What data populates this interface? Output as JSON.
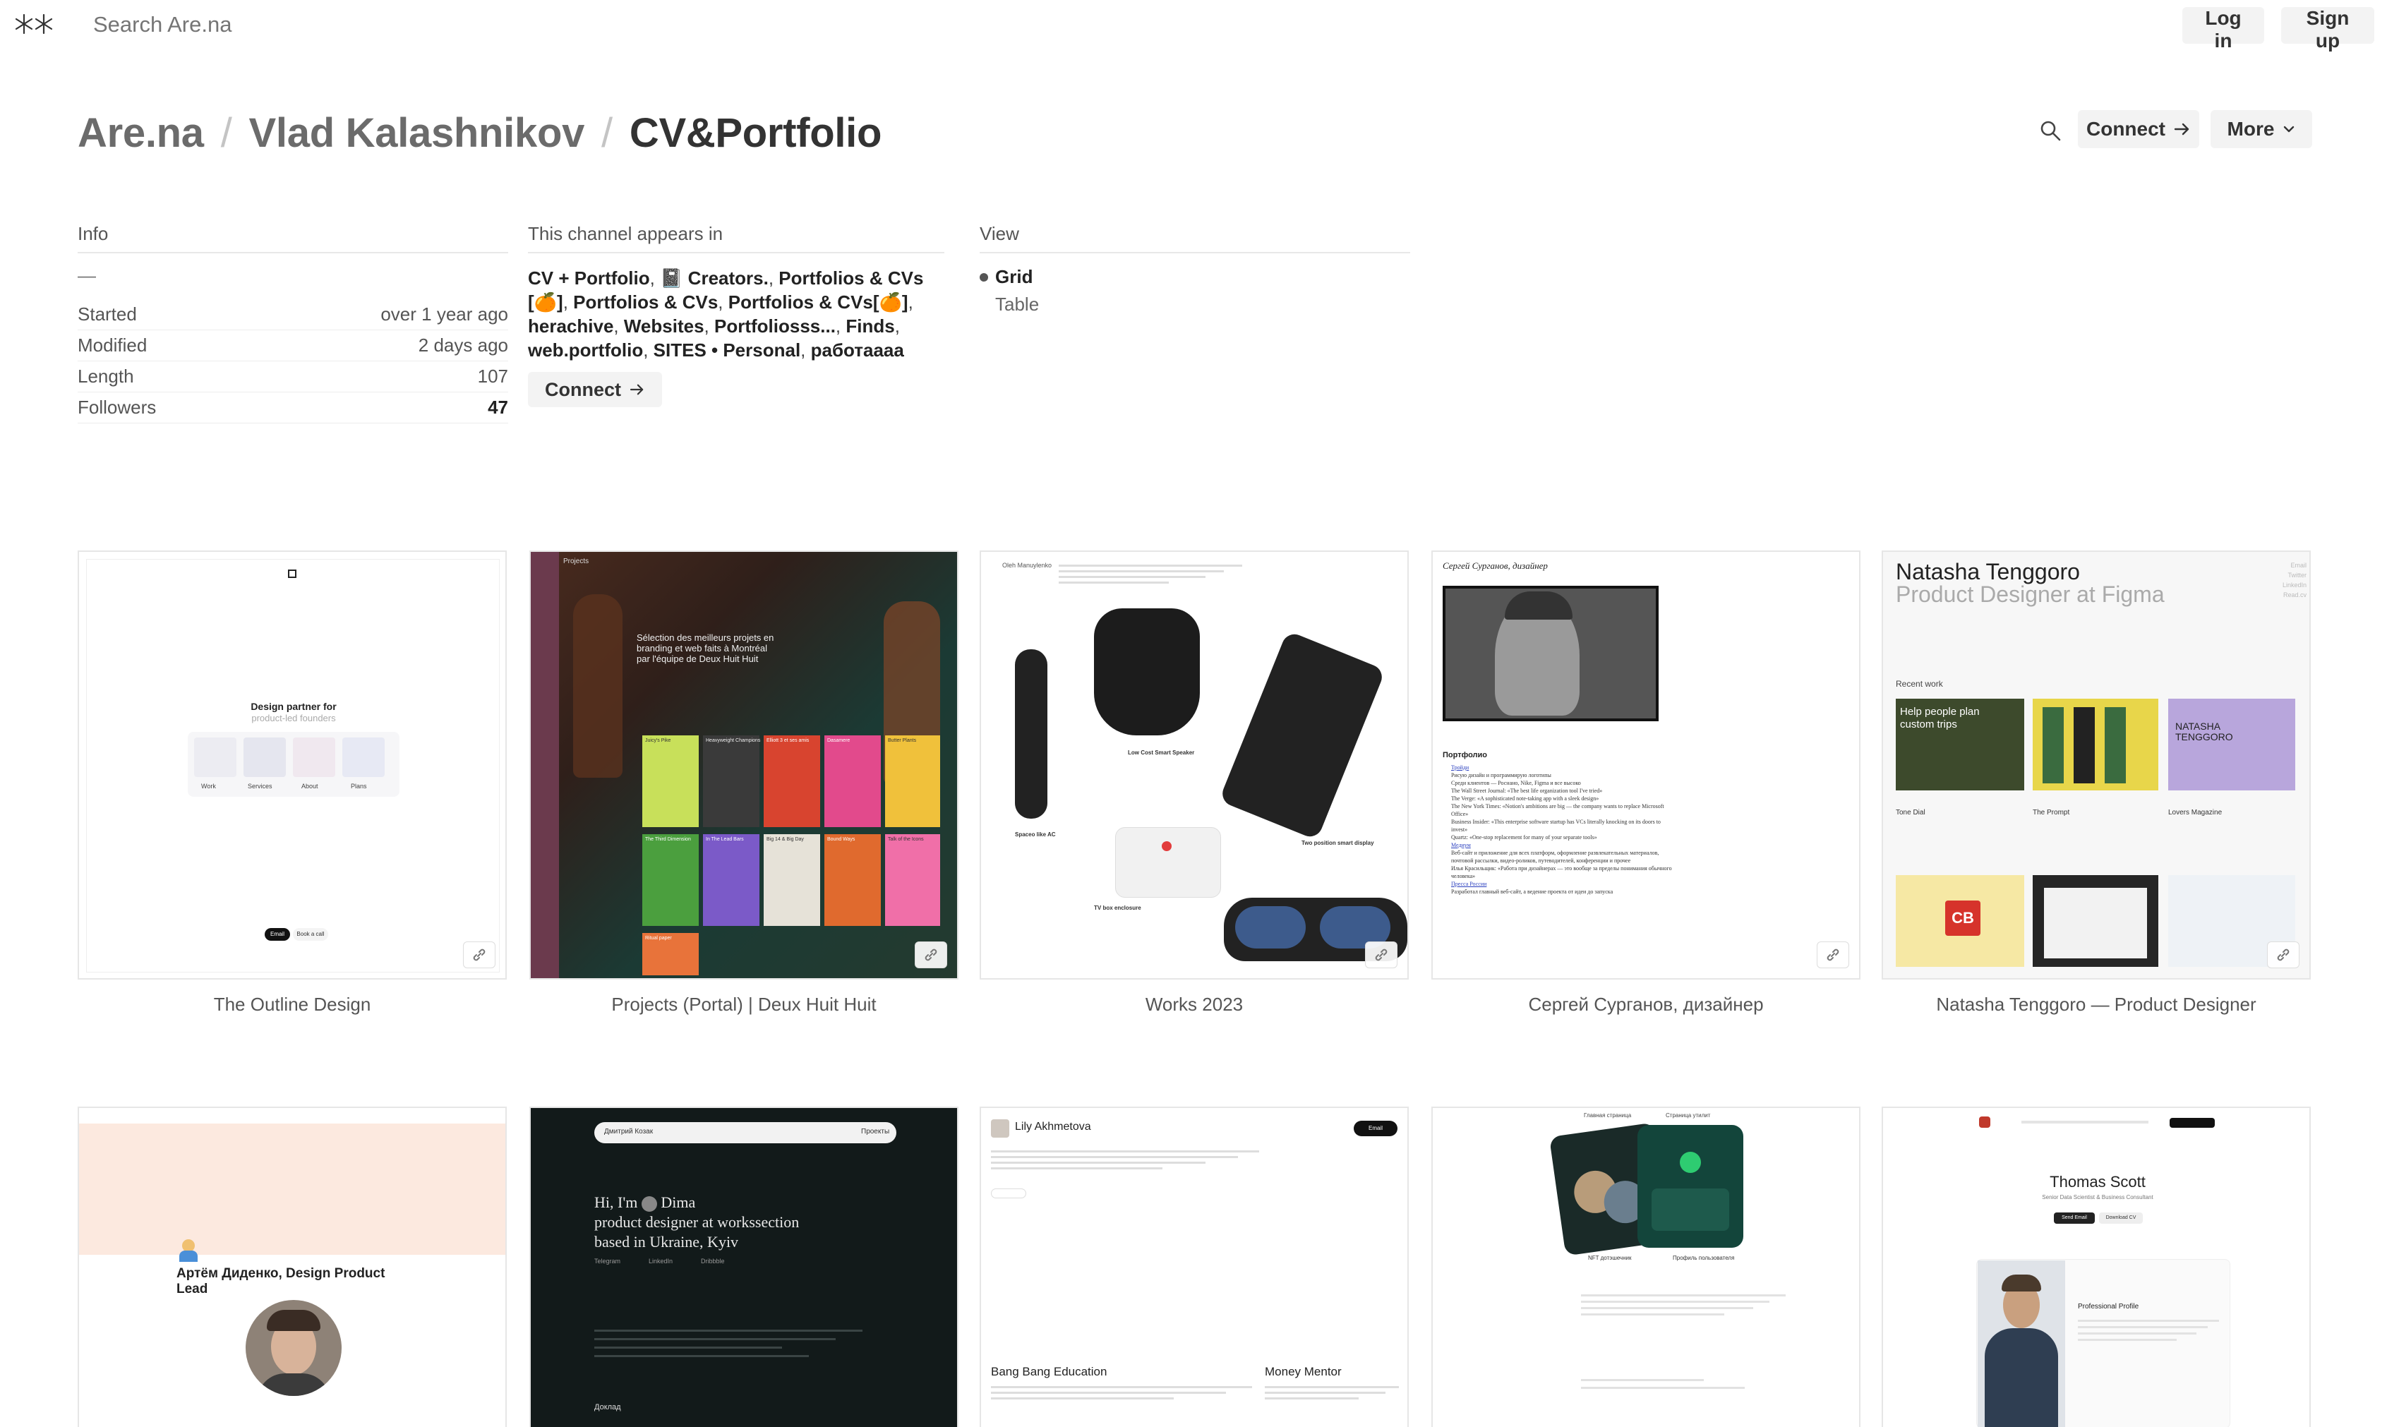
{
  "topbar": {
    "search_placeholder": "Search Are.na",
    "login_label": "Log in",
    "signup_label": "Sign up"
  },
  "breadcrumb": {
    "root": "Are.na",
    "user": "Vlad Kalashnikov",
    "channel": "CV&Portfolio"
  },
  "header_actions": {
    "connect_label": "Connect",
    "more_label": "More"
  },
  "info": {
    "title": "Info",
    "description": "—",
    "rows": [
      {
        "label": "Started",
        "value": "over 1 year ago"
      },
      {
        "label": "Modified",
        "value": "2 days ago"
      },
      {
        "label": "Length",
        "value": "107"
      },
      {
        "label": "Followers",
        "value": "47"
      }
    ]
  },
  "appears": {
    "title": "This channel appears in",
    "channels": [
      "CV + Portfolio",
      "📓 Creators.",
      "Portfolios & CVs [🍊]",
      "Portfolios & CVs",
      "Portfolios & CVs[🍊]",
      "herachive",
      "Websites",
      "Portfoliosss...",
      "Finds",
      "web.portfolio",
      "SITES • Personal",
      "работаааа"
    ],
    "connect_label": "Connect"
  },
  "view": {
    "title": "View",
    "options": [
      "Grid",
      "Table"
    ],
    "selected": "Grid"
  },
  "blocks": {
    "b1": {
      "title": "The Outline Design",
      "headline": "Design partner for",
      "subline": "product-led founders",
      "nav": [
        "Work",
        "Services",
        "About",
        "Plans"
      ],
      "btn1": "Email",
      "btn2": "Book a call"
    },
    "b2": {
      "title": "Projects (Portal) | Deux Huit Huit",
      "nav_label": "Projects",
      "headline": "Sélection des meilleurs projets en branding et web faits à Montréal par l'équipe de Deux Huit Huit",
      "tiles": [
        "Juicy's Pike",
        "Heavyweight Champions",
        "Elliott 3 et ses amis",
        "Dasamere",
        "Butter Plants",
        "The Third Dimension",
        "In The Lead Bars",
        "Big 14 & Big Day",
        "Bound Ways",
        "Talk of the Icons",
        "Ritual paper"
      ]
    },
    "b3": {
      "title": "Works 2023",
      "brand": "Oleh Manuylenko",
      "labels": [
        "Low Cost Smart Speaker",
        "Spaceo like AC",
        "Two position smart display",
        "TV box enclosure"
      ]
    },
    "b4": {
      "title": "Сергей Сурганов, дизайнер",
      "heading": "Сергей Сурганов, дизайнер",
      "section": "Портфолио",
      "items": [
        "Тройди",
        "Рисую дизайн и программирую логотипы",
        "Среди клиентов — Роснано, Nike, Figma и все высоко",
        "The Wall Street Journal: «The best life organization tool I've tried»",
        "The Verge: «A sophisticated note-taking app with a sleek design»",
        "The New York Times: «Notion's ambitions are big — the company wants to replace Microsoft Office»",
        "Business Insider: «This enterprise software startup has VCs literally knocking on its doors to invest»",
        "Quartz: «One-stop replacement for many of your separate tools»",
        "Медиум",
        "Веб-сайт и приложение для всех платформ, оформление развлекательных материалов, почтовой рассылки, видео-роликов, путеводителей, конференции и прочее",
        "Илья Красильщик: «Работа при дизайнерах — это вообще за пределы понимания обычного человека»",
        "Пресса России",
        "Разработал главный веб-сайт, а ведение проекта от идеи до запуска"
      ]
    },
    "b5": {
      "title": "Natasha Tenggoro — Product Designer",
      "name": "Natasha Tenggoro",
      "role": "Product Designer at Figma",
      "recent": "Recent work",
      "side_links": [
        "Email",
        "Twitter",
        "LinkedIn",
        "Read.cv"
      ],
      "works": [
        "Tone Dial",
        "The Prompt",
        "Lovers Magazine"
      ],
      "card1_text": "Help people plan custom trips",
      "card3_text": "NATASHA TENGGORO",
      "cb": "CB"
    },
    "b6": {
      "name": "Артём Диденко, Design Product Lead"
    },
    "b7": {
      "nav_name": "Дмитрий Козак",
      "nav_link": "Проекты",
      "headline_1": "Hi, I'm",
      "headline_name": "Dima",
      "headline_2": "product designer at workssection",
      "headline_3": "based in Ukraine, Kyiv",
      "links": [
        "Telegram",
        "LinkedIn",
        "Dribbble"
      ],
      "footer": "Доклад"
    },
    "b8": {
      "name": "Lily Akhmetova",
      "btn": "Email",
      "proj1": "Bang Bang Education",
      "proj2": "Money Mentor"
    },
    "b9": {
      "tabs": [
        "Главная страница",
        "Страница утилит"
      ],
      "captions": [
        "NFT дотэшечник",
        "Профиль пользователя"
      ]
    },
    "b10": {
      "name": "Thomas Scott",
      "sub": "Senior Data Scientist & Business Consultant",
      "btn1": "Send Email",
      "btn2": "Download CV",
      "section": "Professional Profile"
    }
  }
}
